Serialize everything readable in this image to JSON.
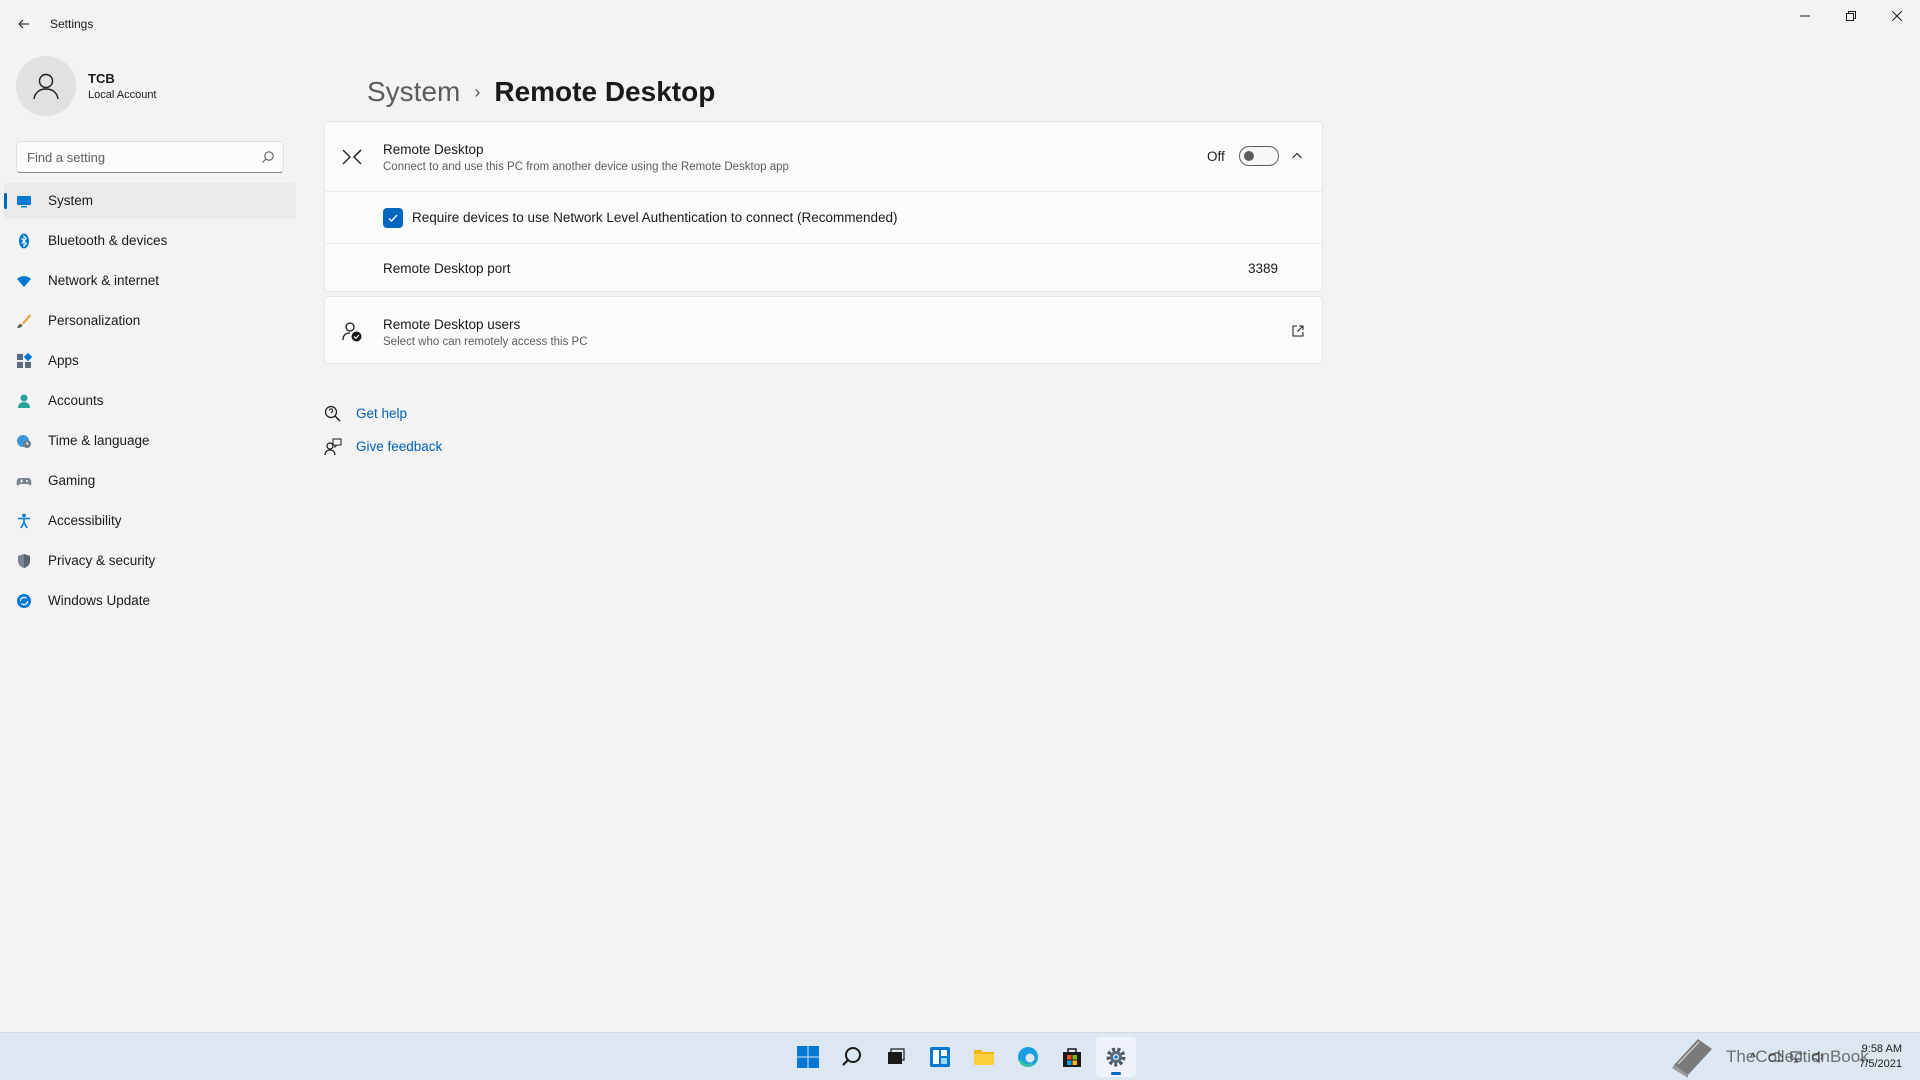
{
  "app": {
    "title": "Settings"
  },
  "profile": {
    "name": "TCB",
    "account_type": "Local Account"
  },
  "search": {
    "placeholder": "Find a setting"
  },
  "sidebar": {
    "items": [
      {
        "label": "System",
        "icon": "system-icon",
        "active": true
      },
      {
        "label": "Bluetooth & devices",
        "icon": "bluetooth-icon"
      },
      {
        "label": "Network & internet",
        "icon": "wifi-icon"
      },
      {
        "label": "Personalization",
        "icon": "brush-icon"
      },
      {
        "label": "Apps",
        "icon": "apps-icon"
      },
      {
        "label": "Accounts",
        "icon": "accounts-icon"
      },
      {
        "label": "Time & language",
        "icon": "globe-clock-icon"
      },
      {
        "label": "Gaming",
        "icon": "gamepad-icon"
      },
      {
        "label": "Accessibility",
        "icon": "accessibility-icon"
      },
      {
        "label": "Privacy & security",
        "icon": "shield-icon"
      },
      {
        "label": "Windows Update",
        "icon": "update-icon"
      }
    ]
  },
  "breadcrumb": {
    "parent": "System",
    "current": "Remote Desktop"
  },
  "remote_desktop": {
    "title": "Remote Desktop",
    "description": "Connect to and use this PC from another device using the Remote Desktop app",
    "toggle_state": "Off",
    "nla_checked": true,
    "nla_label": "Require devices to use Network Level Authentication to connect (Recommended)",
    "port_label": "Remote Desktop port",
    "port_value": "3389"
  },
  "rd_users": {
    "title": "Remote Desktop users",
    "description": "Select who can remotely access this PC"
  },
  "help": {
    "get_help": "Get help",
    "give_feedback": "Give feedback"
  },
  "taskbar": {
    "watermark": "TheCollectionBook",
    "time": "9:58 AM",
    "date": "7/5/2021"
  },
  "colors": {
    "accent": "#0067c0",
    "link": "#005fb8",
    "background": "#f3f3f3"
  }
}
